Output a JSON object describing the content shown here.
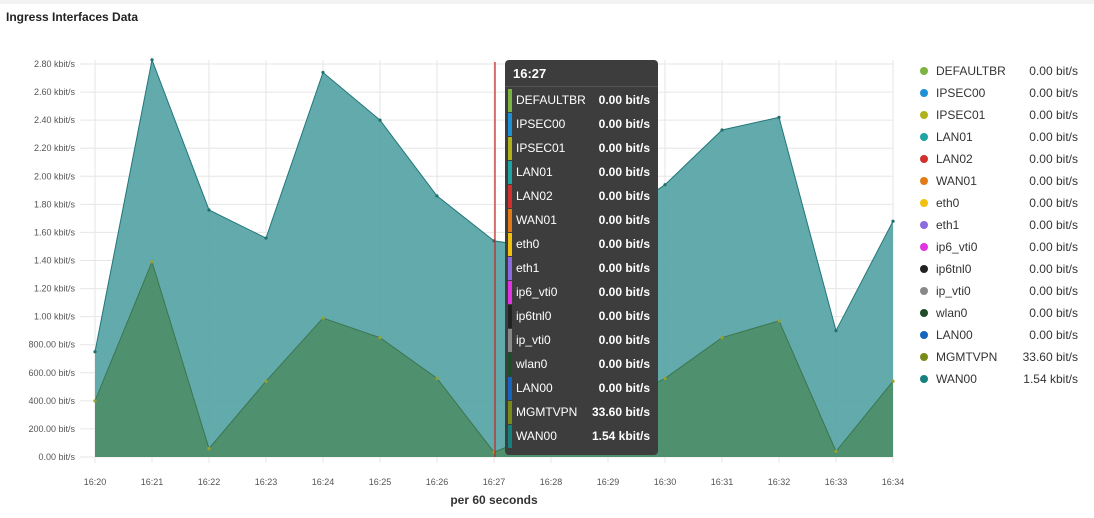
{
  "title": "Ingress Interfaces Data",
  "chart_data": {
    "type": "area",
    "title": "Ingress Interfaces Data",
    "xlabel": "per 60 seconds",
    "ylabel": "",
    "x": [
      "16:20",
      "16:21",
      "16:22",
      "16:23",
      "16:24",
      "16:25",
      "16:26",
      "16:27",
      "16:28",
      "16:29",
      "16:30",
      "16:31",
      "16:32",
      "16:33",
      "16:34"
    ],
    "y_ticks": [
      "0.00 bit/s",
      "200.00 bit/s",
      "400.00 bit/s",
      "600.00 bit/s",
      "800.00 bit/s",
      "1.00 kbit/s",
      "1.20 kbit/s",
      "1.40 kbit/s",
      "1.60 kbit/s",
      "1.80 kbit/s",
      "2.00 kbit/s",
      "2.20 kbit/s",
      "2.40 kbit/s",
      "2.60 kbit/s",
      "2.80 kbit/s"
    ],
    "ylim": [
      0,
      2800
    ],
    "y_unit": "bit/s",
    "grid": true,
    "legend_position": "right",
    "series": [
      {
        "name": "WAN00",
        "color": "#2a8e8e",
        "values": [
          750,
          2830,
          1760,
          1560,
          2740,
          2400,
          1860,
          1540,
          1480,
          1660,
          1940,
          2330,
          2420,
          900,
          1680
        ]
      },
      {
        "name": "MGMTVPN",
        "color": "#4a8a55",
        "values": [
          400,
          1390,
          60,
          540,
          990,
          850,
          560,
          34,
          200,
          350,
          560,
          850,
          970,
          40,
          540
        ]
      }
    ],
    "marker_x": "16:27"
  },
  "legend": [
    {
      "name": "DEFAULTBR",
      "value": "0.00 bit/s",
      "color": "#7cb342"
    },
    {
      "name": "IPSEC00",
      "value": "0.00 bit/s",
      "color": "#1e90d6"
    },
    {
      "name": "IPSEC01",
      "value": "0.00 bit/s",
      "color": "#b0b21a"
    },
    {
      "name": "LAN01",
      "value": "0.00 bit/s",
      "color": "#20a3a3"
    },
    {
      "name": "LAN02",
      "value": "0.00 bit/s",
      "color": "#d0312d"
    },
    {
      "name": "WAN01",
      "value": "0.00 bit/s",
      "color": "#e07b18"
    },
    {
      "name": "eth0",
      "value": "0.00 bit/s",
      "color": "#f2c00f"
    },
    {
      "name": "eth1",
      "value": "0.00 bit/s",
      "color": "#8a6be0"
    },
    {
      "name": "ip6_vti0",
      "value": "0.00 bit/s",
      "color": "#e035e0"
    },
    {
      "name": "ip6tnl0",
      "value": "0.00 bit/s",
      "color": "#222222"
    },
    {
      "name": "ip_vti0",
      "value": "0.00 bit/s",
      "color": "#888888"
    },
    {
      "name": "wlan0",
      "value": "0.00 bit/s",
      "color": "#1f4d2a"
    },
    {
      "name": "LAN00",
      "value": "0.00 bit/s",
      "color": "#1565c0"
    },
    {
      "name": "MGMTVPN",
      "value": "33.60 bit/s",
      "color": "#7a8a1a"
    },
    {
      "name": "WAN00",
      "value": "1.54 kbit/s",
      "color": "#17807e"
    }
  ],
  "tooltip": {
    "time": "16:27",
    "rows": [
      {
        "name": "DEFAULTBR",
        "value": "0.00 bit/s",
        "color": "#7cb342"
      },
      {
        "name": "IPSEC00",
        "value": "0.00 bit/s",
        "color": "#1e90d6"
      },
      {
        "name": "IPSEC01",
        "value": "0.00 bit/s",
        "color": "#b0b21a"
      },
      {
        "name": "LAN01",
        "value": "0.00 bit/s",
        "color": "#20a3a3"
      },
      {
        "name": "LAN02",
        "value": "0.00 bit/s",
        "color": "#d0312d"
      },
      {
        "name": "WAN01",
        "value": "0.00 bit/s",
        "color": "#e07b18"
      },
      {
        "name": "eth0",
        "value": "0.00 bit/s",
        "color": "#f2c00f"
      },
      {
        "name": "eth1",
        "value": "0.00 bit/s",
        "color": "#8a6be0"
      },
      {
        "name": "ip6_vti0",
        "value": "0.00 bit/s",
        "color": "#e035e0"
      },
      {
        "name": "ip6tnl0",
        "value": "0.00 bit/s",
        "color": "#222222"
      },
      {
        "name": "ip_vti0",
        "value": "0.00 bit/s",
        "color": "#888888"
      },
      {
        "name": "wlan0",
        "value": "0.00 bit/s",
        "color": "#1f4d2a"
      },
      {
        "name": "LAN00",
        "value": "0.00 bit/s",
        "color": "#1565c0"
      },
      {
        "name": "MGMTVPN",
        "value": "33.60 bit/s",
        "color": "#7a8a1a"
      },
      {
        "name": "WAN00",
        "value": "1.54 kbit/s",
        "color": "#17807e"
      }
    ]
  }
}
